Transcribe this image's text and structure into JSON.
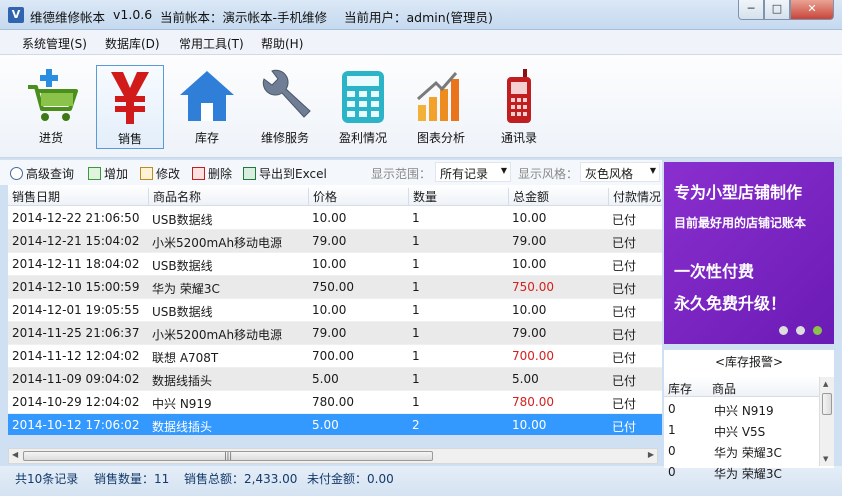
{
  "window": {
    "app_name": "维德维修帐本",
    "version": "v1.0.6",
    "account": "当前帐本：演示帐本-手机维修",
    "user": "当前用户：admin(管理员)",
    "minimize": "─",
    "maximize": "□",
    "close": "✕"
  },
  "menu": [
    "系统管理(S)",
    "数据库(D)",
    "常用工具(T)",
    "帮助(H)"
  ],
  "toolbar": [
    {
      "label": "进货",
      "icon": "shopping-cart-plus-icon"
    },
    {
      "label": "销售",
      "icon": "yen-icon"
    },
    {
      "label": "库存",
      "icon": "house-icon"
    },
    {
      "label": "维修服务",
      "icon": "wrench-icon"
    },
    {
      "label": "盈利情况",
      "icon": "calculator-icon"
    },
    {
      "label": "图表分析",
      "icon": "bar-chart-icon"
    },
    {
      "label": "通讯录",
      "icon": "mobile-phone-icon"
    }
  ],
  "actions": {
    "search": "高级查询",
    "add": "增加",
    "edit": "修改",
    "delete": "删除",
    "export": "导出到Excel"
  },
  "filters": {
    "range_label": "显示范围：",
    "range_value": "所有记录",
    "style_label": "显示风格：",
    "style_value": "灰色风格"
  },
  "table": {
    "columns": [
      "销售日期",
      "商品名称",
      "价格",
      "数量",
      "总金额",
      "付款情况"
    ],
    "rows": [
      [
        "2014-12-22 21:06:50",
        "USB数据线",
        "10.00",
        "1",
        "10.00",
        "已付"
      ],
      [
        "2014-12-21 15:04:02",
        "小米5200mAh移动电源",
        "79.00",
        "1",
        "79.00",
        "已付"
      ],
      [
        "2014-12-11 18:04:02",
        "USB数据线",
        "10.00",
        "1",
        "10.00",
        "已付"
      ],
      [
        "2014-12-10 15:00:59",
        "华为 荣耀3C",
        "750.00",
        "1",
        "750.00",
        "已付"
      ],
      [
        "2014-12-01 19:05:55",
        "USB数据线",
        "10.00",
        "1",
        "10.00",
        "已付"
      ],
      [
        "2014-11-25 21:06:37",
        "小米5200mAh移动电源",
        "79.00",
        "1",
        "79.00",
        "已付"
      ],
      [
        "2014-11-12 12:04:02",
        "联想 A708T",
        "700.00",
        "1",
        "700.00",
        "已付"
      ],
      [
        "2014-11-09 09:04:02",
        "数据线插头",
        "5.00",
        "1",
        "5.00",
        "已付"
      ],
      [
        "2014-10-29 12:04:02",
        "中兴 N919",
        "780.00",
        "1",
        "780.00",
        "已付"
      ],
      [
        "2014-10-12 17:06:02",
        "数据线插头",
        "5.00",
        "2",
        "10.00",
        "已付"
      ]
    ],
    "highlight_rows": [
      3,
      6,
      8
    ],
    "selected_row": 9
  },
  "status": {
    "count": "共10条记录",
    "qty": "销售数量：11",
    "total": "销售总额：2,433.00",
    "unpaid": "未付金额：0.00"
  },
  "promo": {
    "line1": "专为小型店铺制作",
    "line2": "目前最好用的店铺记账本",
    "line3": "一次性付费",
    "line4": "永久免费升级！"
  },
  "stock": {
    "title": "<库存报警>",
    "columns": [
      "库存",
      "商品"
    ],
    "rows": [
      [
        "0",
        "中兴 N919"
      ],
      [
        "1",
        "中兴 V5S"
      ],
      [
        "0",
        "华为 荣耀3C"
      ],
      [
        "0",
        "华为 荣耀3C"
      ]
    ]
  },
  "colors": {
    "selection": "#3399ff",
    "promo": "#7a25c4",
    "alert_text": "#d42020"
  }
}
